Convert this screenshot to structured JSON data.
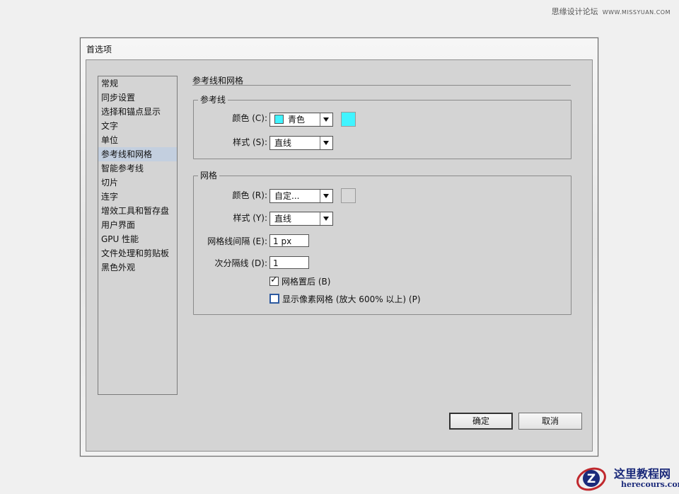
{
  "watermark": {
    "text": "思缘设计论坛",
    "url": "WWW.MISSYUAN.COM"
  },
  "dialog": {
    "title": "首选项",
    "categories": [
      "常规",
      "同步设置",
      "选择和锚点显示",
      "文字",
      "单位",
      "参考线和网格",
      "智能参考线",
      "切片",
      "连字",
      "增效工具和暂存盘",
      "用户界面",
      "GPU 性能",
      "文件处理和剪贴板",
      "黑色外观"
    ],
    "selected_category": "参考线和网格",
    "section_title": "参考线和网格",
    "guides": {
      "legend": "参考线",
      "color_label": "颜色 (C):",
      "color_value": "青色",
      "color_hex": "#40f4ff",
      "style_label": "样式 (S):",
      "style_value": "直线"
    },
    "grid": {
      "legend": "网格",
      "color_label": "颜色 (R):",
      "color_value": "自定...",
      "color_hex": "#d4d4d4",
      "style_label": "样式 (Y):",
      "style_value": "直线",
      "gridline_label": "网格线间隔 (E):",
      "gridline_value": "1 px",
      "subdiv_label": "次分隔线 (D):",
      "subdiv_value": "1",
      "grids_back_label": "网格置后 (B)",
      "grids_back_checked": true,
      "pixel_grid_label": "显示像素网格 (放大 600% 以上) (P)",
      "pixel_grid_checked": false
    },
    "ok_label": "确定",
    "cancel_label": "取消"
  },
  "logo": {
    "cn": "这里教程网",
    "en": "herecours.com",
    "letter": "Z"
  }
}
